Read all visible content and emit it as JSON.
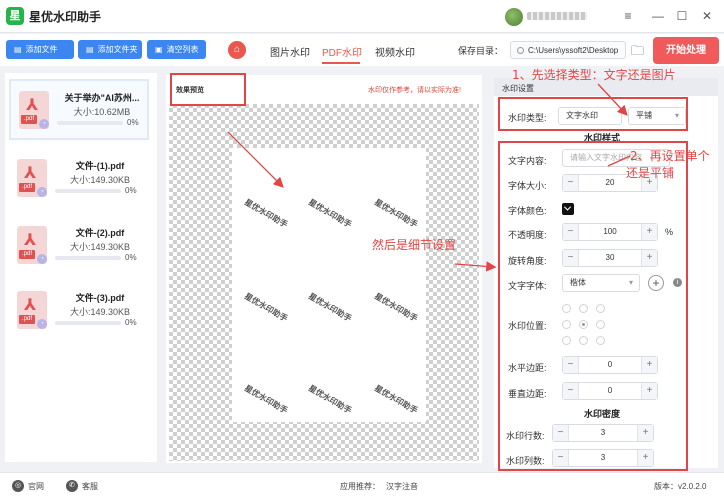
{
  "app": {
    "title": "星优水印助手",
    "logo_glyph": "星"
  },
  "window": {
    "minimize": "—",
    "maximize": "☐",
    "close": "✕",
    "menu": "≡"
  },
  "toolbar": {
    "add_file": "添加文件",
    "add_folder": "添加文件夹",
    "clear_list": "清空列表",
    "tabs": [
      "图片水印",
      "PDF水印",
      "视频水印"
    ],
    "active_tab": "PDF水印",
    "save_label": "保存目录：",
    "save_path": "C:\\Users\\yssoft2\\Desktop",
    "start": "开始处理"
  },
  "files": [
    {
      "name": "关于举办\"AI苏州...",
      "size": "大小:10.62MB",
      "progress": "0%"
    },
    {
      "name": "文件-(1).pdf",
      "size": "大小:149.30KB",
      "progress": "0%"
    },
    {
      "name": "文件-(2).pdf",
      "size": "大小:149.30KB",
      "progress": "0%"
    },
    {
      "name": "文件-(3).pdf",
      "size": "大小:149.30KB",
      "progress": "0%"
    }
  ],
  "pdf_tag": ".pdf",
  "preview": {
    "label": "效果预览",
    "note": "水印仅作参考，请以实际为准!",
    "watermark_text": "星优水印助手"
  },
  "settings": {
    "header": "水印设置",
    "type_label": "水印类型:",
    "type_options": [
      "文字水印",
      "平铺"
    ],
    "style_title": "水印样式",
    "content_label": "文字内容:",
    "content_placeholder": "请输入文字水印内容",
    "font_size_label": "字体大小:",
    "font_size": "20",
    "font_color_label": "字体颜色:",
    "opacity_label": "不透明度:",
    "opacity": "100",
    "opacity_unit": "%",
    "rotation_label": "旋转角度:",
    "rotation": "30",
    "font_family_label": "文字字体:",
    "font_family": "楷体",
    "position_label": "水印位置:",
    "h_margin_label": "水平边距:",
    "h_margin": "0",
    "v_margin_label": "垂直边距:",
    "v_margin": "0",
    "density_title": "水印密度",
    "rows_label": "水印行数:",
    "rows": "3",
    "cols_label": "水印列数:",
    "cols": "3",
    "minus": "−",
    "plus": "+",
    "add": "+",
    "info": "i"
  },
  "annotations": {
    "step1": "1、先选择类型：文字还是图片",
    "step2_line1": "2、再设置单个",
    "step2_line2": "还是平铺",
    "step3": "然后是细节设置"
  },
  "statusbar": {
    "website": "官网",
    "support": "客服",
    "recommend_label": "应用推荐：",
    "recommend_app": "汉字注音",
    "version": "版本：v2.0.2.0"
  },
  "colors": {
    "accent": "#3b86f0",
    "danger": "#e8584c",
    "annotation": "#e24545"
  }
}
